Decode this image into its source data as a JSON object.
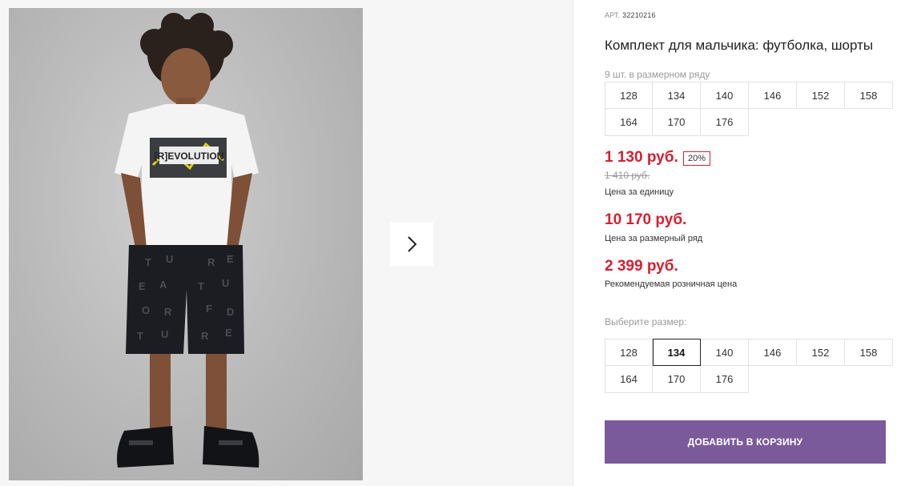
{
  "product": {
    "art_label": "АРТ.",
    "art_value": "32210216",
    "title": "Комплект для мальчика: футболка, шорты",
    "row_count_text": "9 шт. в размерном ряду"
  },
  "size_row": [
    "128",
    "134",
    "140",
    "146",
    "152",
    "158",
    "164",
    "170",
    "176"
  ],
  "pricing": {
    "unit_price": "1 130 руб.",
    "discount_badge": "20%",
    "old_price": "1 410 руб.",
    "unit_caption": "Цена за единицу",
    "row_price": "10 170 руб.",
    "row_caption": "Цена за размерный ряд",
    "rrp_price": "2 399 руб.",
    "rrp_caption": "Рекомендуемая розничная цена"
  },
  "size_select": {
    "label": "Выберите размер:",
    "options": [
      "128",
      "134",
      "140",
      "146",
      "152",
      "158",
      "164",
      "170",
      "176"
    ],
    "selected": "134"
  },
  "cart_button": {
    "label": "ДОБАВИТЬ В КОРЗИНУ"
  },
  "photo": {
    "shirt_print_text": "[R]EVOLUTION"
  },
  "colors": {
    "price_red": "#d42030",
    "button_purple": "#7a5a9a"
  },
  "icons": {
    "next": "chevron-right-icon"
  }
}
